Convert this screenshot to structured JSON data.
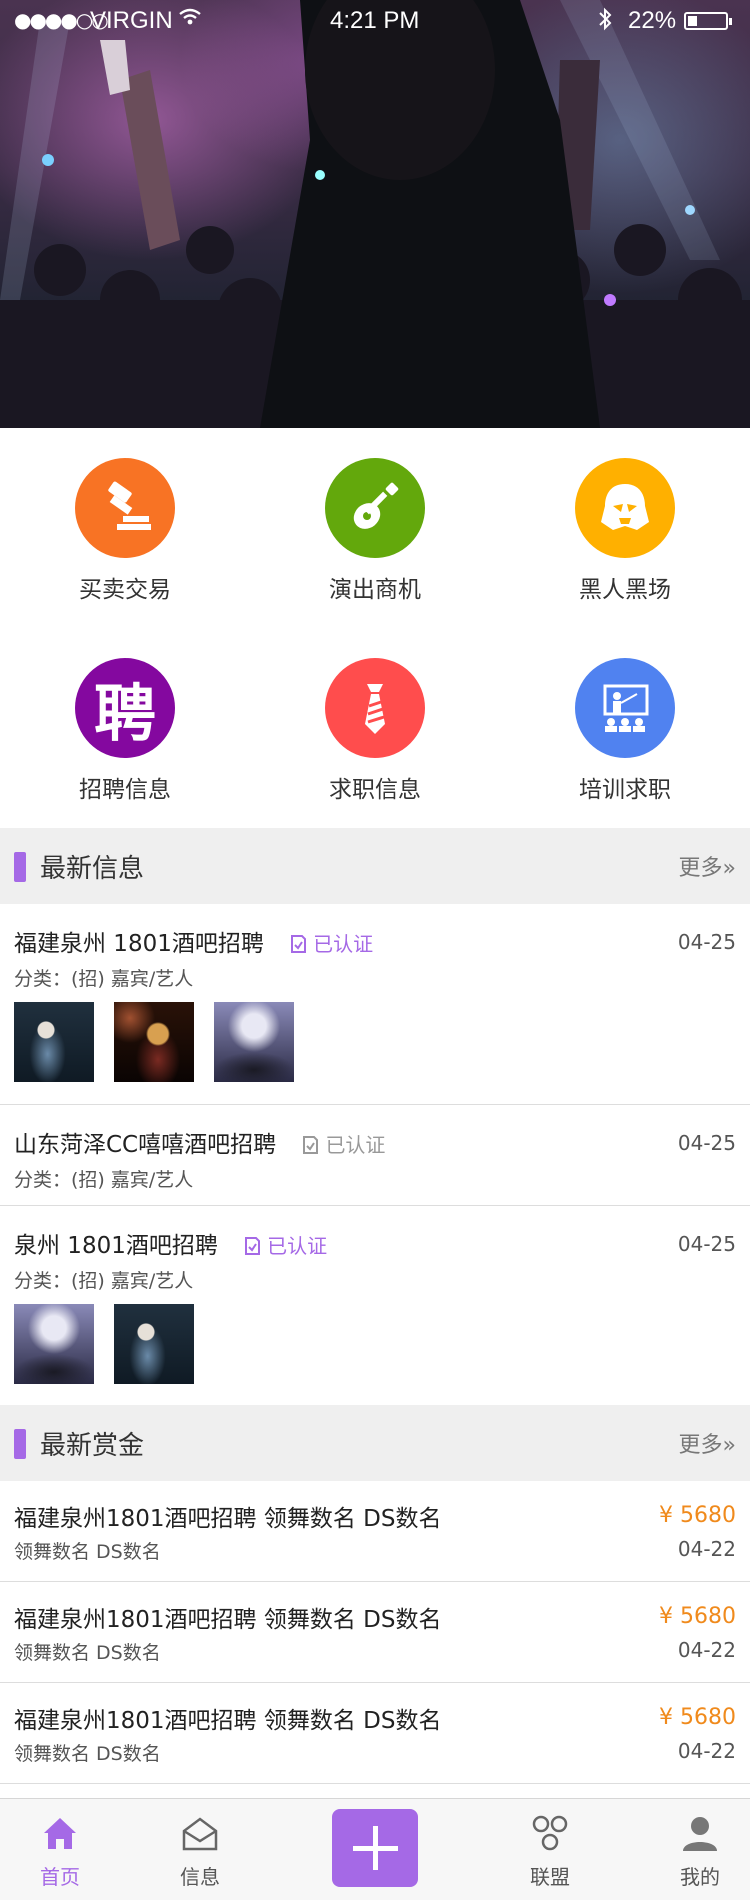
{
  "status_bar": {
    "carrier": "VIRGIN",
    "time": "4:21 PM",
    "battery": "22%"
  },
  "categories": [
    {
      "label": "买卖交易",
      "icon": "gavel-icon",
      "color": "#f87324"
    },
    {
      "label": "演出商机",
      "icon": "guitar-icon",
      "color": "#63a80c"
    },
    {
      "label": "黑人黑场",
      "icon": "darth-vader-icon",
      "color": "#ffb000"
    },
    {
      "label": "招聘信息",
      "icon": "recruit-char-icon",
      "color": "#84089f",
      "glyph": "聘"
    },
    {
      "label": "求职信息",
      "icon": "necktie-icon",
      "color": "#ff4d4d"
    },
    {
      "label": "培训求职",
      "icon": "training-board-icon",
      "color": "#5082f0"
    }
  ],
  "latest_info": {
    "title": "最新信息",
    "more": "更多»",
    "items": [
      {
        "title": "福建泉州 1801酒吧招聘",
        "cert": "已认证",
        "cert_on": true,
        "date": "04-25",
        "category": "分类：(招) 嘉宾/艺人",
        "thumbs": 3
      },
      {
        "title": "山东菏泽CC嘻嘻酒吧招聘",
        "cert": "已认证",
        "cert_on": false,
        "date": "04-25",
        "category": "分类：(招) 嘉宾/艺人",
        "thumbs": 0
      },
      {
        "title": "泉州 1801酒吧招聘",
        "cert": "已认证",
        "cert_on": true,
        "date": "04-25",
        "category": "分类：(招) 嘉宾/艺人",
        "thumbs": 2
      }
    ]
  },
  "latest_bounty": {
    "title": "最新赏金",
    "more": "更多»",
    "items": [
      {
        "title": "福建泉州1801酒吧招聘 领舞数名 DS数名",
        "sub": "领舞数名   DS数名",
        "price": "¥ 5680",
        "date": "04-22"
      },
      {
        "title": "福建泉州1801酒吧招聘 领舞数名 DS数名",
        "sub": "领舞数名   DS数名",
        "price": "¥ 5680",
        "date": "04-22"
      },
      {
        "title": "福建泉州1801酒吧招聘 领舞数名 DS数名",
        "sub": "领舞数名   DS数名",
        "price": "¥ 5680",
        "date": "04-22"
      }
    ]
  },
  "tabbar": {
    "home": "首页",
    "messages": "信息",
    "alliance": "联盟",
    "mine": "我的"
  },
  "colors": {
    "accent": "#a569e6",
    "price": "#f08a1c"
  }
}
